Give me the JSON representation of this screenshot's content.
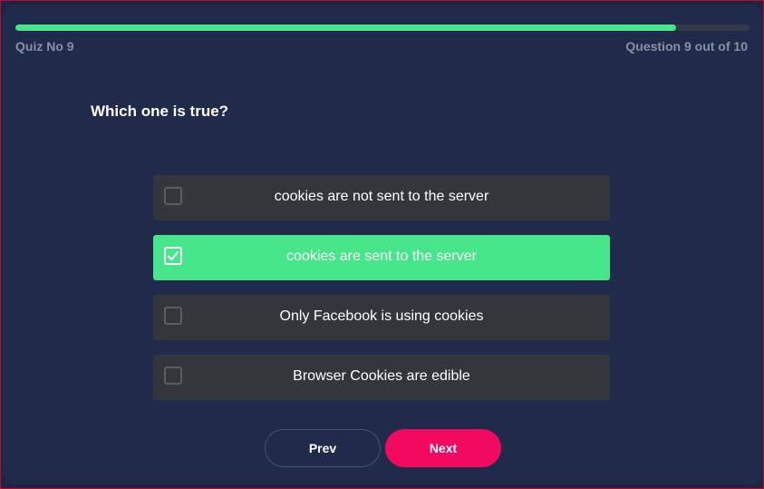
{
  "quiz": {
    "label": "Quiz No 9",
    "counter": "Question 9 out of 10",
    "progress": 0.9
  },
  "question": {
    "text": "Which one is true?"
  },
  "options": [
    {
      "label": "cookies are not sent to the server",
      "checked": false
    },
    {
      "label": "cookies are sent to the server",
      "checked": true
    },
    {
      "label": "Only Facebook is using cookies",
      "checked": false
    },
    {
      "label": "Browser Cookies are edible",
      "checked": false
    }
  ],
  "nav": {
    "prev_label": "Prev",
    "next_label": "Next"
  },
  "colors": {
    "accent": "#47e68a",
    "next_button": "#f20a60",
    "background": "#202a4b",
    "option_background": "#33373c"
  },
  "icons": {
    "checked": "check-icon"
  }
}
